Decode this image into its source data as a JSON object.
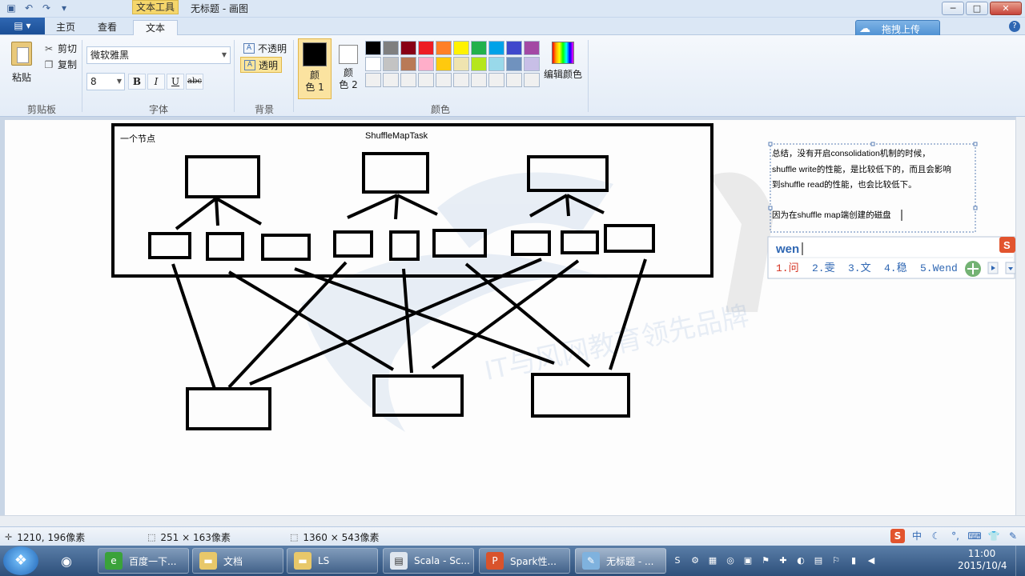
{
  "window": {
    "context_tab": "文本工具",
    "title": "无标题 - 画图",
    "minimize": "─",
    "maximize": "□",
    "close": "✕"
  },
  "tabs": [
    "主页",
    "查看",
    "文本"
  ],
  "upload_button": "拖拽上传",
  "ribbon": {
    "clipboard": {
      "paste": "粘贴",
      "cut": "剪切",
      "copy": "复制",
      "label": "剪贴板"
    },
    "font": {
      "family": "微软雅黑",
      "size": "8",
      "bold": "B",
      "italic": "I",
      "underline": "U",
      "strike": "abc",
      "label": "字体"
    },
    "background": {
      "opaque": "不透明",
      "transparent": "透明",
      "label": "背景"
    },
    "colors": {
      "color1": [
        "颜",
        "色 1"
      ],
      "color2": [
        "颜",
        "色 2"
      ],
      "edit": "编辑颜色",
      "label": "颜色",
      "palette": [
        "#000000",
        "#7f7f7f",
        "#880015",
        "#ed1c24",
        "#ff7f27",
        "#fff200",
        "#22b14c",
        "#00a2e8",
        "#3f48cc",
        "#a349a4",
        "#ffffff",
        "#c3c3c3",
        "#b97a57",
        "#ffaec9",
        "#ffc90e",
        "#efe4b0",
        "#b5e61d",
        "#99d9ea",
        "#7092be",
        "#c8bfe7",
        "#f0f0f0",
        "#f0f0f0",
        "#f0f0f0",
        "#f0f0f0",
        "#f0f0f0",
        "#f0f0f0",
        "#f0f0f0",
        "#f0f0f0",
        "#f0f0f0",
        "#f0f0f0"
      ]
    }
  },
  "canvas": {
    "node_label": "一个节点",
    "task_label": "ShuffleMapTask",
    "textbox_lines": [
      "总结，没有开启consolidation机制的时候，",
      "shuffle write的性能，是比较低下的，而且会影响",
      "到shuffle read的性能，也会比较低下。",
      "",
      "因为在shuffle map端创建的磁盘"
    ],
    "watermark": "IT与风网教育领先品牌"
  },
  "ime": {
    "input": "wen",
    "candidates": [
      "1.问",
      "2.雯",
      "3.文",
      "4.稳",
      "5.Wend"
    ]
  },
  "status": {
    "cursor_pos": "1210, 196像素",
    "selection_size": "251 × 163像素",
    "canvas_size": "1360 × 543像素"
  },
  "taskbar": {
    "tasks": [
      "百度一下...",
      "文档",
      "LS",
      "Scala - Sc...",
      "Spark性...",
      "无标题 - ..."
    ],
    "time": "11:00",
    "date": "2015/10/4"
  }
}
